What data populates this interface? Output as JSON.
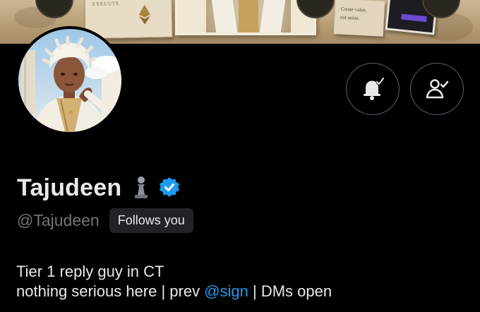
{
  "banner": {
    "execute_label": "EXECUTE",
    "note_line_1": "Create value,",
    "note_line_2": "not noise."
  },
  "profile": {
    "display_name": "Tajudeen",
    "handle": "@Tajudeen",
    "follows_you_label": "Follows you",
    "bio_line_1": "Tier 1 reply guy in CT",
    "bio_line_2_prefix": "nothing serious here | prev ",
    "bio_mention": "@sign",
    "bio_line_2_suffix": " | DMs open"
  },
  "icons": {
    "display_name_emoji": "chess-pawn-icon",
    "verified": "verified-badge-icon",
    "notifications_button": "bell-check-icon",
    "follow_button": "person-check-icon"
  },
  "colors": {
    "background": "#000000",
    "text_primary": "#e7e9ea",
    "text_secondary": "#71767b",
    "link": "#1d9bf0",
    "verified": "#1d9bf0",
    "badge_bg": "#202327",
    "button_border": "#536471"
  }
}
